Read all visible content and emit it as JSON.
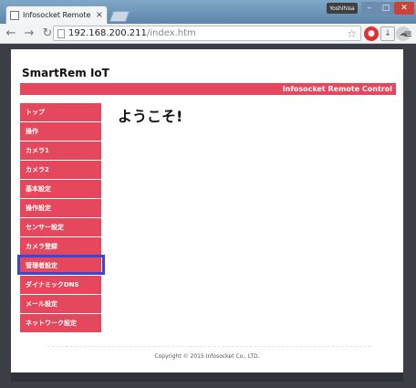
{
  "browser": {
    "tab_title": "Infosocket Remote Cont",
    "tab_close": "×",
    "user_badge": "Yoshihisa",
    "window_controls": {
      "minimize": "–",
      "maximize": "□",
      "close": "✕"
    },
    "nav": {
      "back": "←",
      "forward": "→",
      "reload": "↻"
    },
    "url_host": "192.168.200.211",
    "url_path": "/index.htm",
    "star": "☆",
    "menu": "≡"
  },
  "site": {
    "title": "SmartRem IoT",
    "banner": "Infosocket Remote Control",
    "welcome": "ようこそ!",
    "footer": "Copyright © 2015 Infosocket Co., LTD."
  },
  "sidebar": {
    "items": [
      {
        "label": "トップ"
      },
      {
        "label": "操作"
      },
      {
        "label": "カメラ1"
      },
      {
        "label": "カメラ2"
      },
      {
        "label": "基本設定"
      },
      {
        "label": "操作設定"
      },
      {
        "label": "センサー設定"
      },
      {
        "label": "カメラ登録"
      },
      {
        "label": "管理者設定"
      },
      {
        "label": "ダイナミックDNS"
      },
      {
        "label": "メール設定"
      },
      {
        "label": "ネットワーク設定"
      }
    ]
  },
  "colors": {
    "accent": "#e5475c",
    "highlight": "#3a47d6"
  }
}
